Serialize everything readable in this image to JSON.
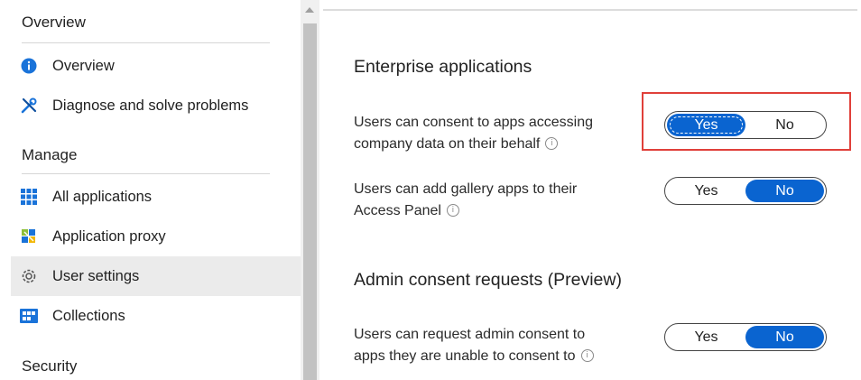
{
  "sidebar": {
    "sections": [
      {
        "heading": "Overview"
      },
      {
        "heading": "Manage"
      },
      {
        "heading": "Security"
      }
    ],
    "items": [
      {
        "label": "Overview",
        "icon": "info-icon"
      },
      {
        "label": "Diagnose and solve problems",
        "icon": "wrench-icon"
      },
      {
        "label": "All applications",
        "icon": "grid-icon"
      },
      {
        "label": "Application proxy",
        "icon": "proxy-icon"
      },
      {
        "label": "User settings",
        "icon": "gear-icon",
        "selected": true
      },
      {
        "label": "Collections",
        "icon": "collections-icon"
      }
    ]
  },
  "main": {
    "enterprise": {
      "heading": "Enterprise applications",
      "settings": [
        {
          "line1": "Users can consent to apps accessing",
          "line2": "company data on their behalf",
          "yes": "Yes",
          "no": "No",
          "selected": "Yes"
        },
        {
          "line1": "Users can add gallery apps to their",
          "line2": "Access Panel",
          "yes": "Yes",
          "no": "No",
          "selected": "No"
        }
      ]
    },
    "admin": {
      "heading": "Admin consent requests (Preview)",
      "settings": [
        {
          "line1": "Users can request admin consent to",
          "line2": "apps they are unable to consent to",
          "yes": "Yes",
          "no": "No",
          "selected": "No"
        }
      ]
    }
  },
  "colors": {
    "accent": "#0a64d0",
    "highlight": "#e0403a",
    "selected_bg": "#ebebeb"
  }
}
